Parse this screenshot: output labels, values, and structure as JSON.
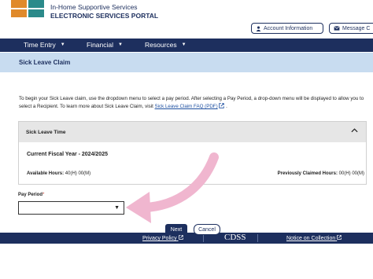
{
  "header": {
    "brand_line1": "In-Home Supportive Services",
    "brand_line2": "ELECTRONIC SERVICES PORTAL",
    "account_btn": "Account Information",
    "message_btn": "Message C"
  },
  "nav": {
    "items": [
      "Time Entry",
      "Financial",
      "Resources"
    ]
  },
  "page": {
    "title": "Sick Leave Claim",
    "intro": "To begin your Sick Leave claim, use the dropdown menu to select a pay period. After selecting a Pay Period, a drop-down menu will be displayed to allow you to select a Recipient. To learn more about Sick Leave Claim, visit ",
    "faq_link": "Sick Leave Claim FAQ (PDF)",
    "intro_end": " ."
  },
  "card": {
    "title": "Sick Leave Time",
    "fiscal_year": "Current Fiscal Year - 2024/2025",
    "available_label": "Available Hours:",
    "available_value": "40(H) 00(M)",
    "claimed_label": "Previously Claimed Hours:",
    "claimed_value": "00(H) 00(M)"
  },
  "form": {
    "pay_period_label": "Pay Period",
    "required_mark": "*",
    "pay_period_value": "",
    "next": "Next",
    "cancel": "Cancel"
  },
  "footer": {
    "privacy": "Privacy Policy",
    "logo": "CDSS",
    "notice": "Notice on Collection"
  },
  "colors": {
    "navy": "#1d2f5e",
    "banner": "#c8dcf0",
    "annotation": "#f0b6cf"
  },
  "icons": [
    "user-icon",
    "mail-icon",
    "caret-down-icon",
    "chevron-up-icon",
    "external-link-icon",
    "annotation-arrow"
  ]
}
